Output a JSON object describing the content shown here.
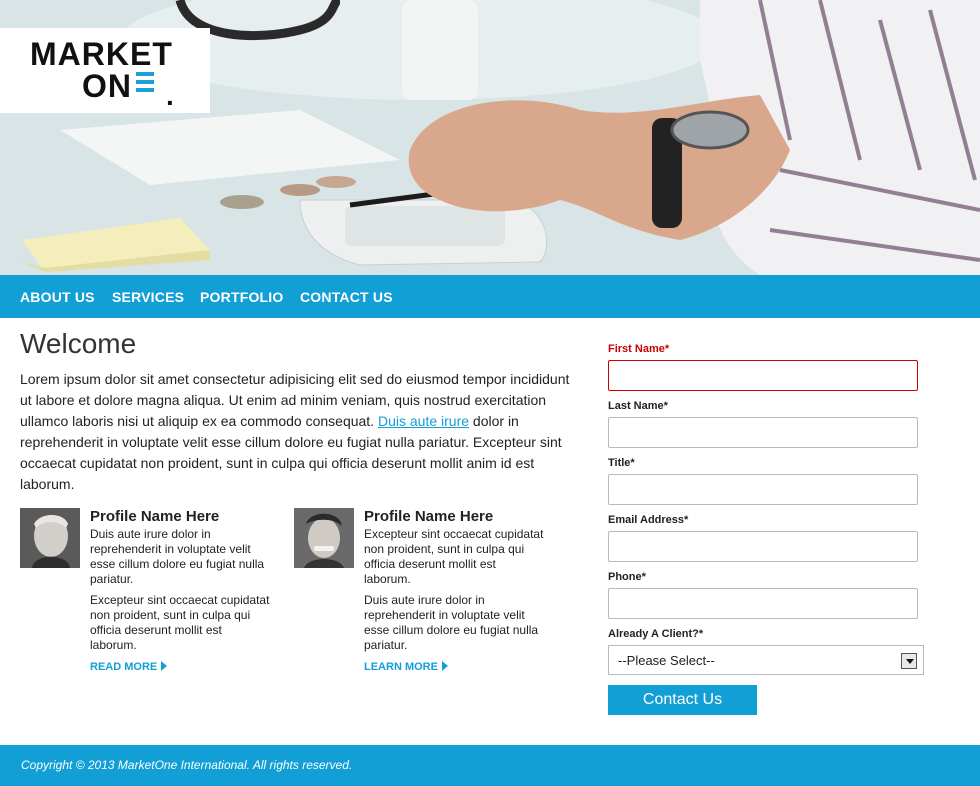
{
  "logo": {
    "line1": "MARKET",
    "line2": "ON",
    "mark": "."
  },
  "nav": {
    "items": [
      {
        "label": "ABOUT US"
      },
      {
        "label": "SERVICES"
      },
      {
        "label": "PORTFOLIO"
      },
      {
        "label": "CONTACT US"
      }
    ]
  },
  "main": {
    "title": "Welcome",
    "intro_before": "Lorem ipsum dolor sit amet consectetur adipisicing elit sed do eiusmod tempor incididunt ut labore et dolore magna aliqua. Ut enim ad minim veniam, quis nostrud exercitation ullamco laboris nisi ut aliquip ex ea commodo consequat. ",
    "intro_link": "Duis aute irure",
    "intro_after": " dolor in reprehenderit in voluptate velit esse cillum dolore eu fugiat nulla pariatur. Excepteur sint occaecat cupidatat non proident, sunt in culpa qui officia deserunt mollit anim id est laborum."
  },
  "profiles": [
    {
      "name": "Profile Name Here",
      "p1": "Duis aute irure dolor in reprehenderit in voluptate velit esse cillum dolore eu fugiat nulla pariatur.",
      "p2": "Excepteur sint occaecat cupidatat non proident, sunt in culpa qui officia deserunt mollit est laborum.",
      "link": "READ MORE"
    },
    {
      "name": "Profile Name Here",
      "p1": "Excepteur sint occaecat cupidatat non proident, sunt in culpa qui officia deserunt mollit est laborum.",
      "p2": "Duis aute irure dolor in reprehenderit in voluptate velit esse cillum dolore eu fugiat nulla pariatur.",
      "link": "LEARN MORE"
    }
  ],
  "form": {
    "first_name": "First Name*",
    "last_name": "Last Name*",
    "title": "Title*",
    "email": "Email Address*",
    "phone": "Phone*",
    "client": "Already A Client?*",
    "client_value": "--Please Select--",
    "submit": "Contact Us"
  },
  "footer": {
    "copyright": "Copyright © 2013 MarketOne International. All rights reserved."
  },
  "colors": {
    "accent": "#129fd6",
    "error": "#cc0000"
  }
}
